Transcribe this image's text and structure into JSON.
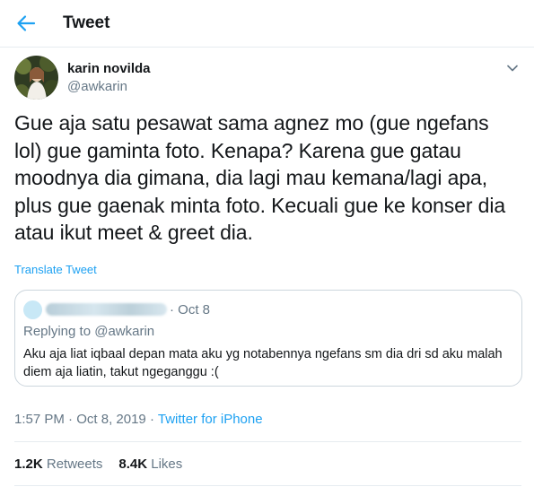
{
  "header": {
    "title": "Tweet",
    "back_icon": "arrow-left-icon",
    "accent_color": "#1da1f2"
  },
  "tweet": {
    "author": {
      "display_name": "karin novilda",
      "handle": "@awkarin",
      "avatar": "profile-photo"
    },
    "text": "Gue aja satu pesawat sama agnez mo (gue ngefans lol) gue gaminta foto. Kenapa? Karena gue gatau moodnya dia gimana, dia lagi mau kemana/lagi apa, plus gue gaenak minta foto. Kecuali gue ke konser dia atau ikut meet & greet dia.",
    "translate_label": "Translate Tweet",
    "quoted": {
      "date": "· Oct 8",
      "replying_to": "Replying to @awkarin",
      "text": "Aku aja liat iqbaal depan mata aku yg notabennya ngefans sm dia dri sd aku malah diem aja liatin, takut ngeganggu :("
    },
    "meta": {
      "time": "1:57 PM",
      "separator": "·",
      "date": "Oct 8, 2019",
      "source": "Twitter for iPhone"
    },
    "stats": {
      "retweets_count": "1.2K",
      "retweets_label": "Retweets",
      "likes_count": "8.4K",
      "likes_label": "Likes"
    }
  }
}
